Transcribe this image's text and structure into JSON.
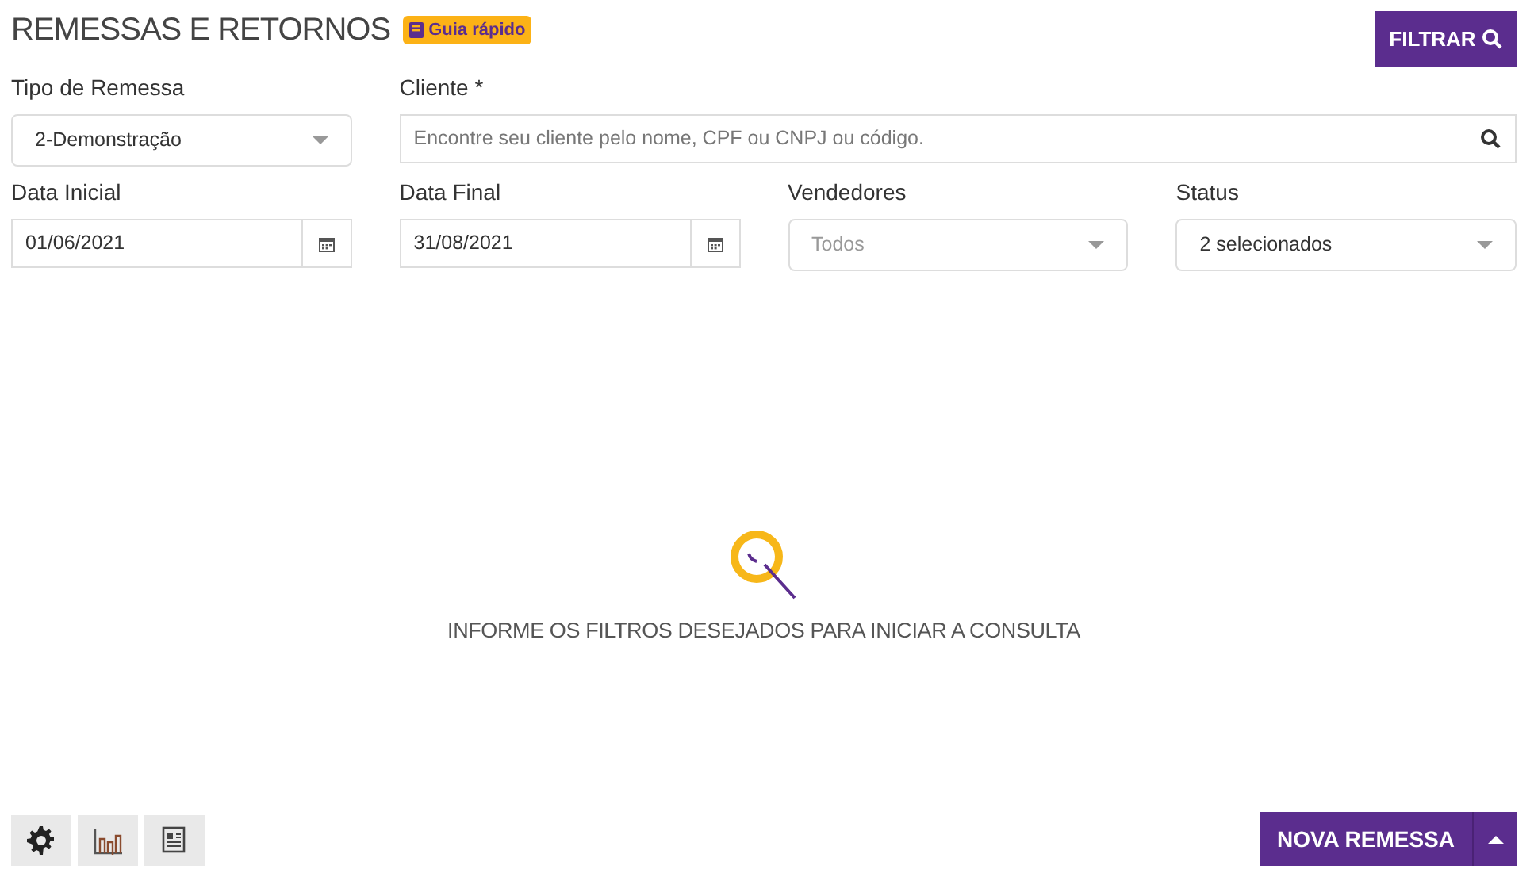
{
  "header": {
    "title": "REMESSAS E RETORNOS",
    "guide_badge": "Guia rápido",
    "filter_button": "FILTRAR"
  },
  "filter_rows": [
    [
      {
        "kind": "select",
        "label": "Tipo de Remessa",
        "value": "2-Demonstração"
      },
      {
        "kind": "search",
        "label": "Cliente *",
        "placeholder": "Encontre seu cliente pelo nome, CPF ou CNPJ ou código."
      }
    ],
    [
      {
        "kind": "date",
        "label": "Data Inicial",
        "value": "01/06/2021"
      },
      {
        "kind": "date",
        "label": "Data Final",
        "value": "31/08/2021"
      },
      {
        "kind": "select",
        "label": "Vendedores",
        "placeholder": "Todos"
      },
      {
        "kind": "select",
        "label": "Status",
        "value": "2 selecionados"
      }
    ]
  ],
  "empty_state": {
    "message": "INFORME OS FILTROS DESEJADOS PARA INICIAR A CONSULTA"
  },
  "footer": {
    "tool_buttons": [
      {
        "kind": "settings"
      },
      {
        "kind": "chart"
      },
      {
        "kind": "report"
      }
    ],
    "primary_button": "NOVA REMESSA"
  }
}
